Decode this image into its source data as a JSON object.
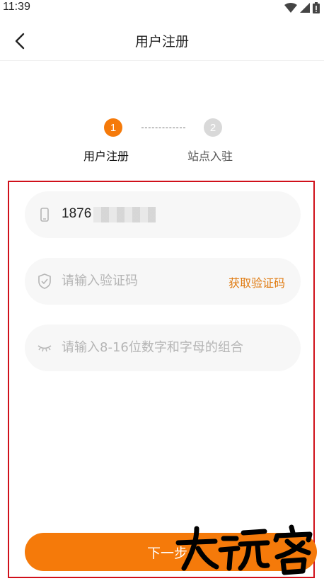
{
  "status_bar": {
    "time": "11:39"
  },
  "header": {
    "title": "用户注册"
  },
  "steps": [
    {
      "number": "1",
      "label": "用户注册"
    },
    {
      "number": "2",
      "label": "站点入驻"
    }
  ],
  "form": {
    "phone_value": "1876",
    "code_placeholder": "请输入验证码",
    "get_code_label": "获取验证码",
    "password_placeholder": "请输入8-16位数字和字母的组合"
  },
  "next_button_label": "下一步",
  "colors": {
    "accent": "#f57a0a",
    "highlight_frame": "#d0101a"
  }
}
